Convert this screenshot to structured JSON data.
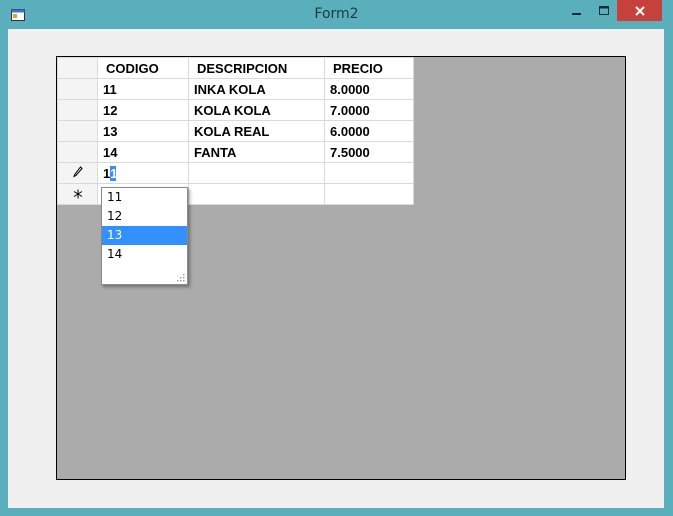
{
  "window": {
    "title": "Form2"
  },
  "grid": {
    "columns": [
      "CODIGO",
      "DESCRIPCION",
      "PRECIO"
    ],
    "rows": [
      {
        "codigo": "11",
        "descripcion": "INKA KOLA",
        "precio": "8.0000"
      },
      {
        "codigo": "12",
        "descripcion": "KOLA KOLA",
        "precio": "7.0000"
      },
      {
        "codigo": "13",
        "descripcion": "KOLA REAL",
        "precio": "6.0000"
      },
      {
        "codigo": "14",
        "descripcion": "FANTA",
        "precio": "7.5000"
      }
    ],
    "edit_row": {
      "typed": "1",
      "selected_suffix": "1"
    },
    "row_markers": {
      "edit": "pencil-icon",
      "new": "asterisk-icon"
    },
    "suggestions": [
      "11",
      "12",
      "13",
      "14"
    ],
    "highlighted_suggestion": "13"
  },
  "colors": {
    "titlebar": "#5aafbd",
    "close": "#c7413c",
    "selection": "#3390ff",
    "grid_background": "#ababab"
  }
}
